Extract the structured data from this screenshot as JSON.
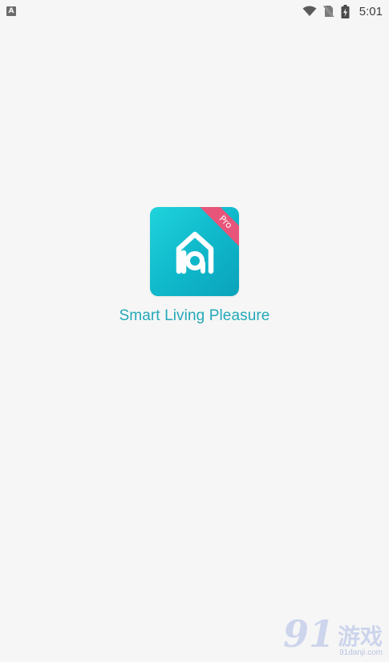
{
  "status_bar": {
    "notification_glyph": "A",
    "time": "5:01",
    "icons": [
      "wifi-icon",
      "no-sim-icon",
      "battery-charging-icon"
    ]
  },
  "splash": {
    "icon_badge": "Pro",
    "app_name": "Smart Living Pleasure",
    "colors": {
      "accent_text": "#23a9b8",
      "icon_gradient_start": "#1fd3dc",
      "icon_gradient_end": "#0aa3bb",
      "ribbon": "#e8557a",
      "background": "#f6f6f6"
    }
  },
  "watermark": {
    "number": "91",
    "chinese": "游戏",
    "url": "91danji.com"
  }
}
